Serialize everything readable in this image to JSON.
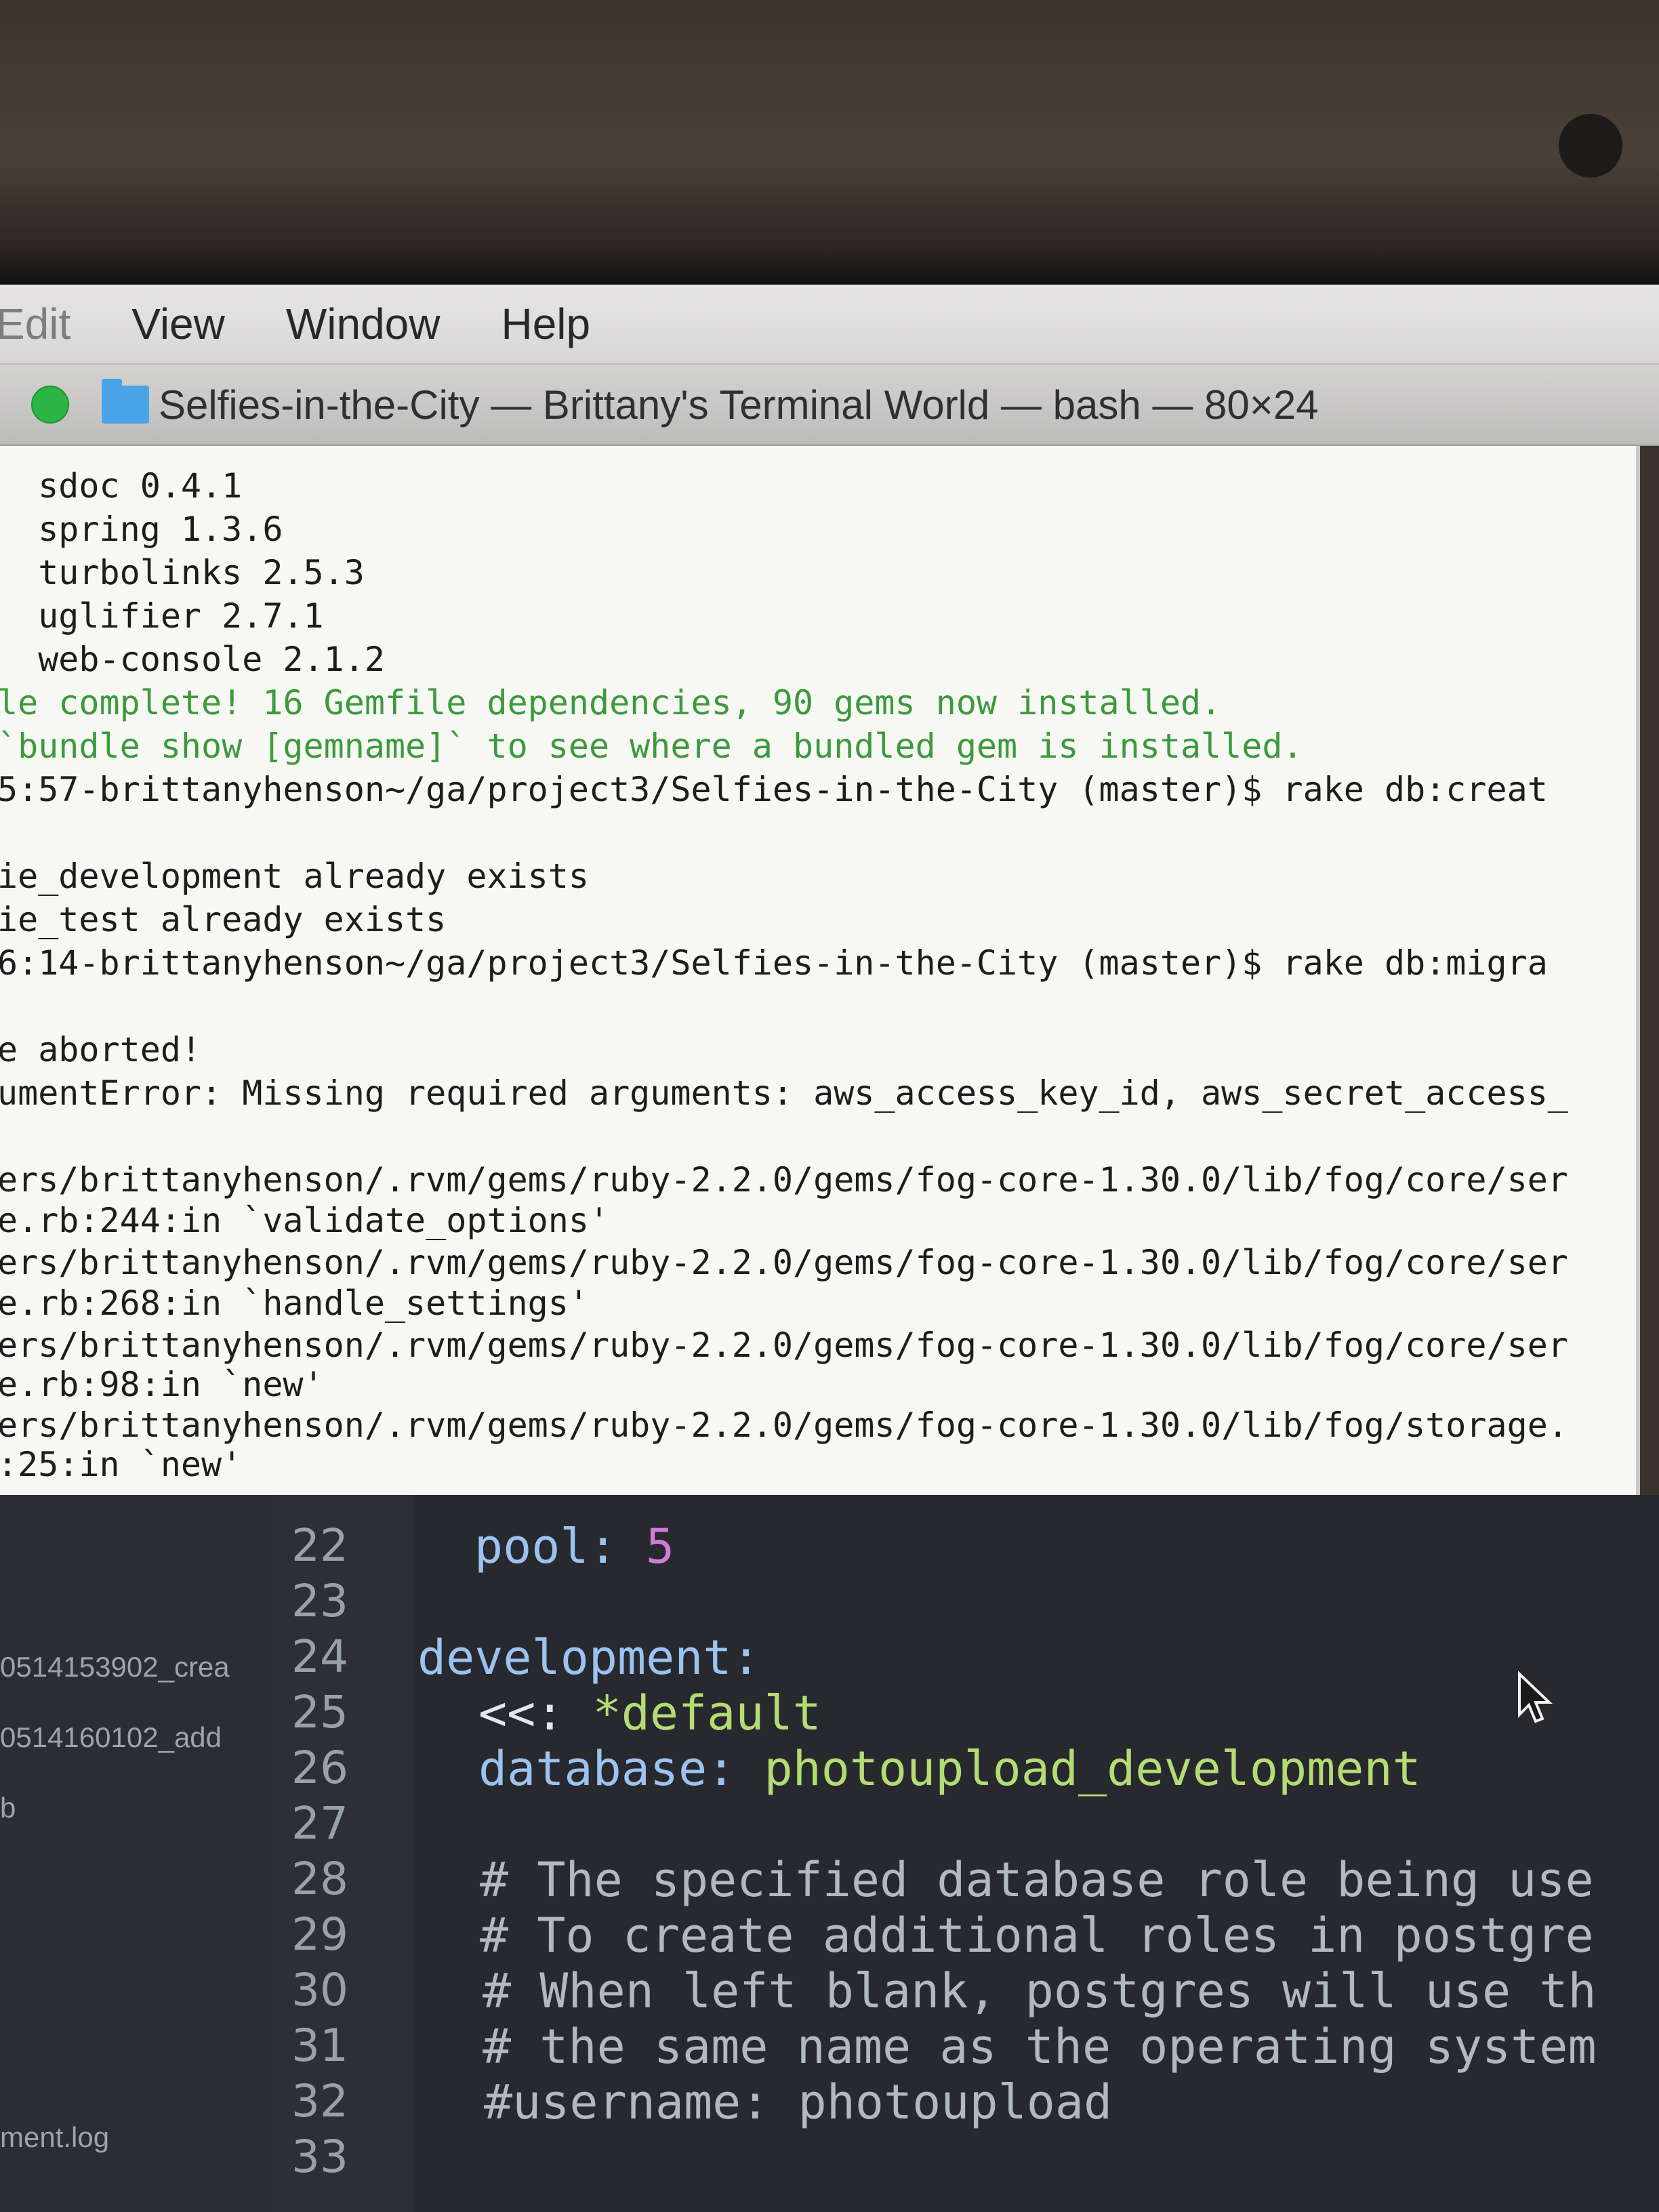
{
  "menubar": {
    "items": [
      "Edit",
      "View",
      "Window",
      "Help"
    ]
  },
  "window": {
    "title": "Selfies-in-the-City — Brittany's Terminal World — bash — 80×24"
  },
  "terminal": {
    "lines": [
      "  sdoc 0.4.1",
      "  spring 1.3.6",
      "  turbolinks 2.5.3",
      "  uglifier 2.7.1",
      "  web-console 2.1.2",
      "le complete! 16 Gemfile dependencies, 90 gems now installed.",
      "`bundle show [gemname]` to see where a bundled gem is installed.",
      "5:57-brittanyhenson~/ga/project3/Selfies-in-the-City (master)$ rake db:creat",
      "",
      "ie_development already exists",
      "ie_test already exists",
      "6:14-brittanyhenson~/ga/project3/Selfies-in-the-City (master)$ rake db:migra",
      "",
      "e aborted!",
      "umentError: Missing required arguments: aws_access_key_id, aws_secret_access_",
      "",
      "ers/brittanyhenson/.rvm/gems/ruby-2.2.0/gems/fog-core-1.30.0/lib/fog/core/ser",
      "e.rb:244:in `validate_options'",
      "ers/brittanyhenson/.rvm/gems/ruby-2.2.0/gems/fog-core-1.30.0/lib/fog/core/ser",
      "e.rb:268:in `handle_settings'",
      "ers/brittanyhenson/.rvm/gems/ruby-2.2.0/gems/fog-core-1.30.0/lib/fog/core/ser",
      "e.rb:98:in `new'",
      "ers/brittanyhenson/.rvm/gems/ruby-2.2.0/gems/fog-core-1.30.0/lib/fog/storage.",
      ":25:in `new'"
    ]
  },
  "sidebar": {
    "files": [
      "0514153902_crea",
      "0514160102_add",
      "b",
      "ment.log"
    ]
  },
  "editor": {
    "line_numbers": [
      "22",
      "23",
      "24",
      "25",
      "26",
      "27",
      "28",
      "29",
      "30",
      "31",
      "32",
      "33"
    ],
    "code": {
      "l22_key": "pool: ",
      "l22_val": "5",
      "l24_key": "development:",
      "l25_key": "<<: ",
      "l25_val": "*default",
      "l26_key": "database: ",
      "l26_val": "photoupload_development",
      "l28": "# The specified database role being use",
      "l29": "# To create additional roles in postgre",
      "l30": "# When left blank, postgres will use th",
      "l31": "# the same name as the operating system",
      "l32": "#username: photoupload"
    }
  }
}
